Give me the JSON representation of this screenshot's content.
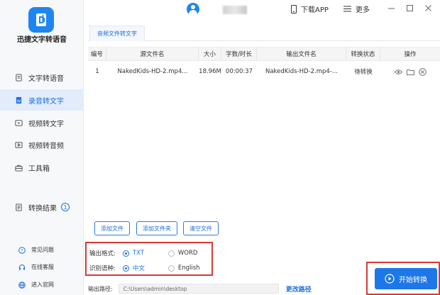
{
  "app": {
    "name": "迅捷文字转语音",
    "logo_icon": "document-d-logo"
  },
  "sidebar": {
    "items": [
      {
        "label": "文字转语音",
        "icon": "document-icon"
      },
      {
        "label": "录音转文字",
        "icon": "word-doc-icon",
        "active": true
      },
      {
        "label": "视频转文字",
        "icon": "video-icon"
      },
      {
        "label": "视频转音频",
        "icon": "video-audio-icon"
      },
      {
        "label": "工具箱",
        "icon": "toolbox-icon"
      }
    ],
    "results": {
      "label": "转换结果",
      "count": "1"
    },
    "footer": [
      {
        "label": "常见问题",
        "icon": "question-icon"
      },
      {
        "label": "在线客服",
        "icon": "headset-icon"
      },
      {
        "label": "进入官网",
        "icon": "globe-icon"
      }
    ]
  },
  "titlebar": {
    "download_label": "下载APP",
    "more_label": "更多"
  },
  "tabs": [
    {
      "label": "音频文件转文字"
    }
  ],
  "table": {
    "headers": [
      "编号",
      "源文件名",
      "大小",
      "字数/时长",
      "输出文件名",
      "转换状态",
      "操作"
    ],
    "rows": [
      {
        "index": "1",
        "source": "NakedKids-HD-2.mp4...",
        "size": "18.96M",
        "duration": "00:00:37",
        "output": "NakedKids-HD-2.mp4-...",
        "status": "待转换"
      }
    ]
  },
  "actions": {
    "add_file": "添加文件",
    "add_folder": "添加文件夹",
    "clear": "清空文件"
  },
  "options": {
    "format": {
      "label": "输出格式:",
      "choices": [
        "TXT",
        "WORD"
      ],
      "selected": "TXT"
    },
    "language": {
      "label": "识别语种:",
      "choices": [
        "中文",
        "English"
      ],
      "selected": "中文"
    }
  },
  "output_path": {
    "label": "输出路径:",
    "value": "C:\\Users\\admin\\desktop",
    "change_label": "更改路径"
  },
  "start_button": {
    "label": "开始转换"
  },
  "colors": {
    "accent": "#1d77e8",
    "highlight_border": "#d83a34"
  }
}
